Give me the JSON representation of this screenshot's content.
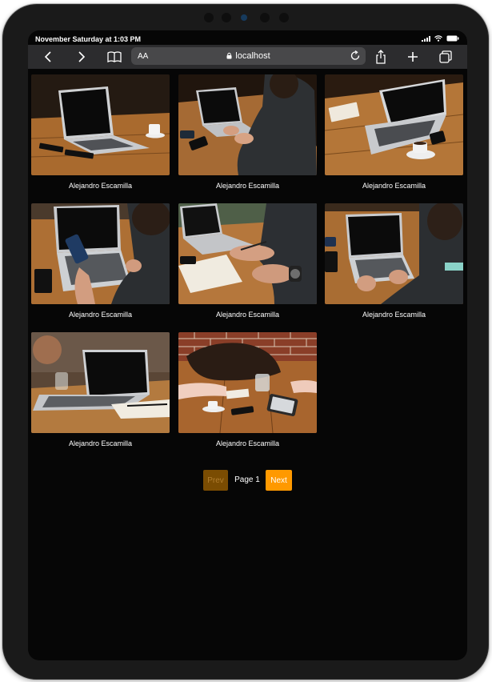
{
  "status_bar": {
    "time": "November Saturday at 1:03 PM"
  },
  "browser": {
    "text_size_label": "AA",
    "url": "localhost",
    "icons": [
      "back-icon",
      "forward-icon",
      "bookmarks-icon",
      "lock-icon",
      "reload-icon",
      "share-icon",
      "new-tab-icon",
      "tabs-icon"
    ]
  },
  "gallery": {
    "items": [
      {
        "author": "Alejandro Escamilla"
      },
      {
        "author": "Alejandro Escamilla"
      },
      {
        "author": "Alejandro Escamilla"
      },
      {
        "author": "Alejandro Escamilla"
      },
      {
        "author": "Alejandro Escamilla"
      },
      {
        "author": "Alejandro Escamilla"
      },
      {
        "author": "Alejandro Escamilla"
      },
      {
        "author": "Alejandro Escamilla"
      }
    ]
  },
  "pagination": {
    "prev_label": "Prev",
    "page_label": "Page 1",
    "next_label": "Next"
  },
  "colors": {
    "accent": "#ff9900",
    "prev_disabled": "#7a4c02",
    "background": "#060606"
  }
}
